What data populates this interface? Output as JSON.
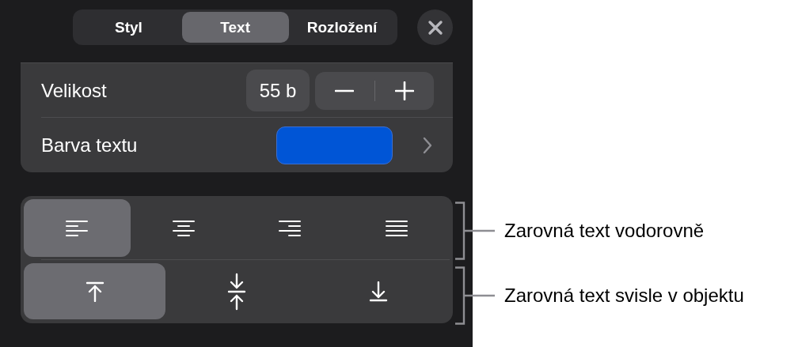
{
  "tabs": [
    {
      "label": "Styl",
      "selected": false
    },
    {
      "label": "Text",
      "selected": true
    },
    {
      "label": "Rozložení",
      "selected": false
    }
  ],
  "size": {
    "label": "Velikost",
    "value": "55 b"
  },
  "text_color": {
    "label": "Barva textu",
    "color": "#0055d6"
  },
  "horizontal_alignment": [
    {
      "kind": "left",
      "selected": true
    },
    {
      "kind": "center",
      "selected": false
    },
    {
      "kind": "right",
      "selected": false
    },
    {
      "kind": "justify",
      "selected": false
    }
  ],
  "vertical_alignment": [
    {
      "kind": "top",
      "selected": true
    },
    {
      "kind": "middle",
      "selected": false
    },
    {
      "kind": "bottom",
      "selected": false
    }
  ],
  "callouts": [
    {
      "text": "Zarovná text vodorovně"
    },
    {
      "text": "Zarovná text svisle v objektu"
    }
  ]
}
